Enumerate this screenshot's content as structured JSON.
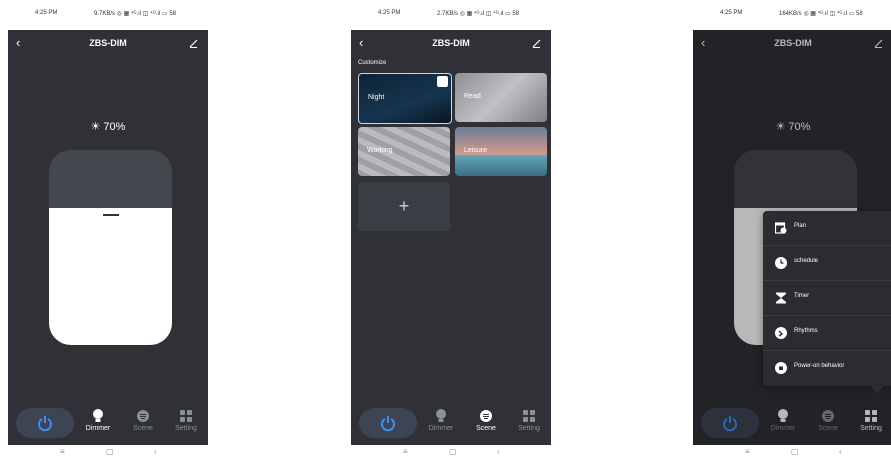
{
  "screens": [
    {
      "status": {
        "time": "4:25 PM",
        "net": "9.7KB/s ◎ ▦ ⁴ᴳ.ıl ◫ ⁴ᴳ.ıl ▭ 58"
      },
      "title": "ZBS-DIM",
      "brightness": "70%",
      "level": 0.7,
      "tabs": [
        "Dimmer",
        "Scene",
        "Setting"
      ],
      "active_tab": "Dimmer"
    },
    {
      "status": {
        "time": "4:25 PM",
        "net": "2.7KB/s ◎ ▦ ⁴ᴳ.ıl ◫ ⁴ᴳ.ıl ▭ 58"
      },
      "title": "ZBS-DIM",
      "section": "Customize",
      "scenes": [
        "Night",
        "Read",
        "Working",
        "Leisure"
      ],
      "add": "+",
      "tabs": [
        "Dimmer",
        "Scene",
        "Setting"
      ],
      "active_tab": "Scene"
    },
    {
      "status": {
        "time": "4:25 PM",
        "net": "164KB/s ◎ ▦ ⁴ᴳ.ıl ◫ ⁴ᴳ.ıl ▭ 58"
      },
      "title": "ZBS-DIM",
      "brightness": "70%",
      "level": 0.7,
      "menu": [
        "Plan",
        "schedule",
        "Timer",
        "Rhythms",
        "Power-on behavior"
      ],
      "tabs": [
        "Dimmer",
        "Scene",
        "Setting"
      ]
    }
  ],
  "icons": {
    "back": "chevron-left-icon",
    "edit": "edit-icon",
    "power": "power-icon"
  },
  "colors": {
    "background": "#2f3136",
    "accent": "#3d8ef0",
    "slider_track": "#44474d"
  }
}
